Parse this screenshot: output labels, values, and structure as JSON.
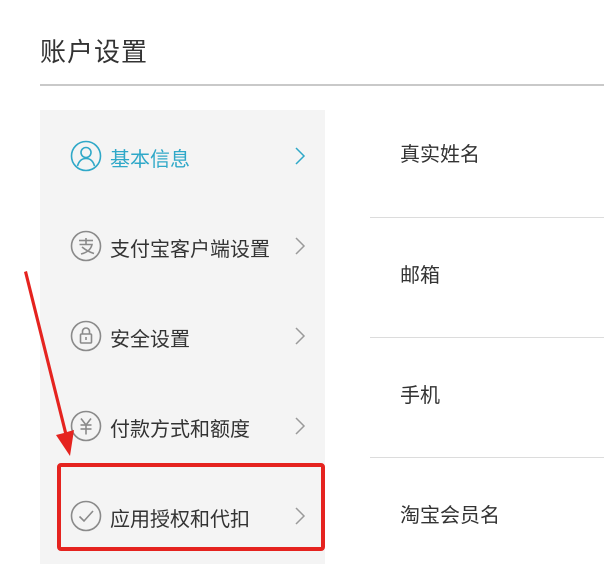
{
  "page": {
    "title": "账户设置"
  },
  "sidebar": {
    "items": [
      {
        "label": "基本信息",
        "icon": "user-icon",
        "active": true
      },
      {
        "label": "支付宝客户端设置",
        "icon": "alipay-icon",
        "active": false
      },
      {
        "label": "安全设置",
        "icon": "lock-icon",
        "active": false
      },
      {
        "label": "付款方式和额度",
        "icon": "yuan-icon",
        "active": false
      },
      {
        "label": "应用授权和代扣",
        "icon": "check-circle-icon",
        "active": false
      }
    ]
  },
  "fields": {
    "items": [
      {
        "label": "真实姓名"
      },
      {
        "label": "邮箱"
      },
      {
        "label": "手机"
      },
      {
        "label": "淘宝会员名"
      }
    ]
  },
  "colors": {
    "accent": "#2fa8c8",
    "highlight": "#e5231f",
    "sidebar_bg": "#f4f4f4",
    "text": "#333333",
    "icon_gray": "#8a8a8a"
  }
}
